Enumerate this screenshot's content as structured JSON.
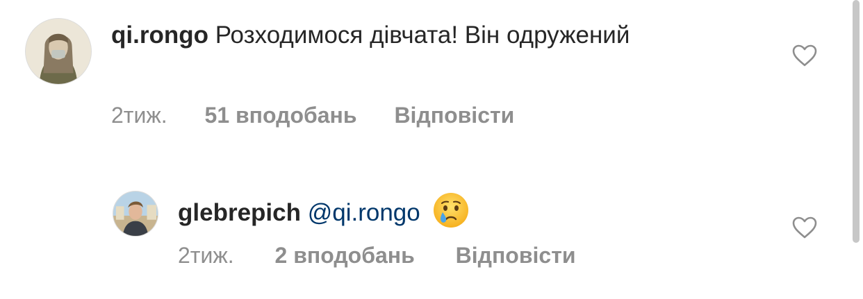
{
  "comments": [
    {
      "username": "qi.rongo",
      "text": "Розходимося дівчата! Він одружений",
      "time": "2тиж.",
      "likes": "51 вподобань",
      "reply": "Відповісти"
    },
    {
      "username": "glebrepich",
      "mention": "@qi.rongo",
      "text": "",
      "emoji": "crying-face-icon",
      "time": "2тиж.",
      "likes": "2 вподобань",
      "reply": "Відповісти"
    }
  ],
  "colors": {
    "text": "#262626",
    "meta": "#8e8e8e",
    "mention": "#00376b"
  }
}
